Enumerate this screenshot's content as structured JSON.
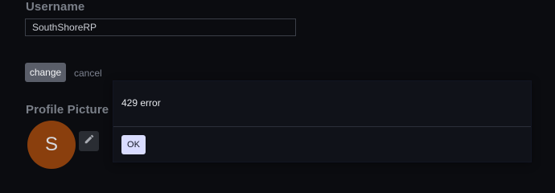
{
  "settings": {
    "username_title": "Username",
    "username_value": "SouthShoreRP",
    "change_label": "change",
    "cancel_label": "cancel",
    "profile_picture_title": "Profile Picture",
    "avatar_initial": "S",
    "avatar_color": "#8a3f0d",
    "edit_icon": "pencil-icon"
  },
  "modal": {
    "message": "429 error",
    "ok_label": "OK",
    "ok_color": "#d9dcff"
  }
}
